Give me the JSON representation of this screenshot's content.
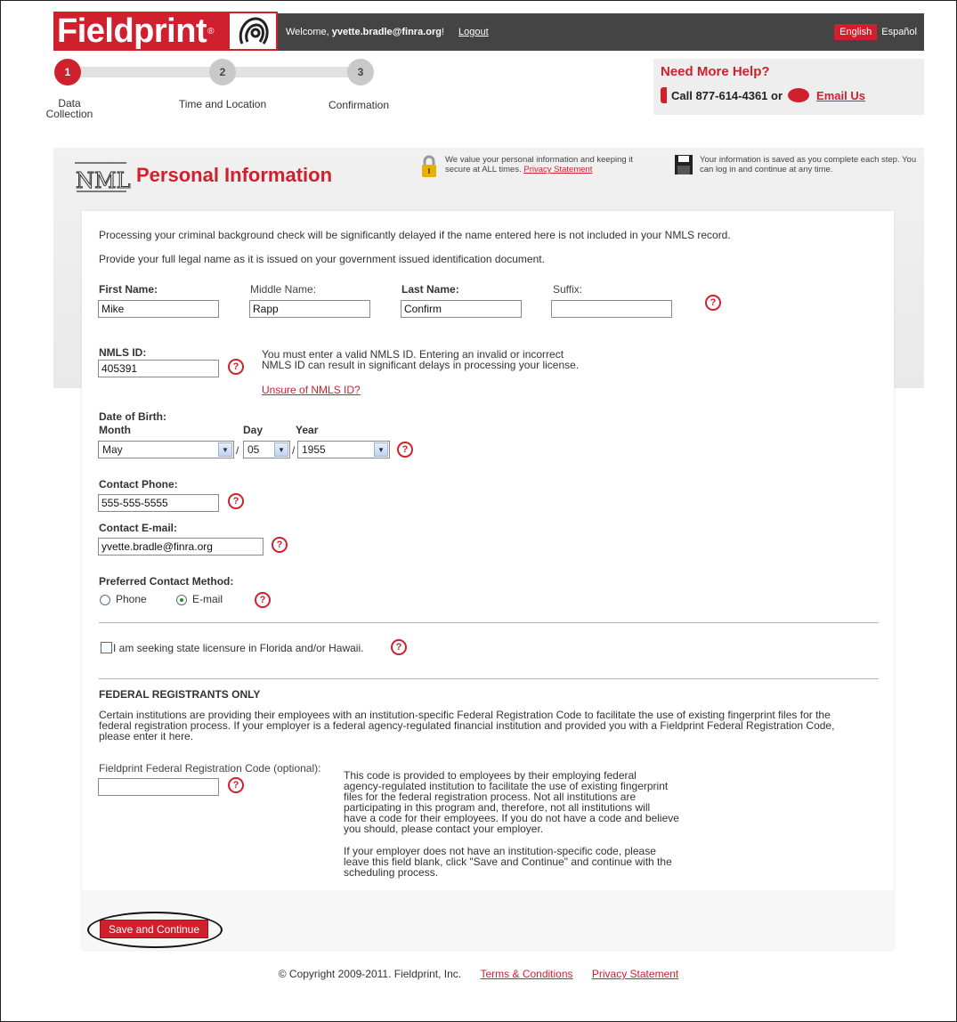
{
  "header": {
    "logo_text": "Fieldprint",
    "welcome_prefix": "Welcome, ",
    "welcome_user": "yvette.bradle@finra.org",
    "welcome_suffix": "!",
    "logout": "Logout",
    "lang_english": "English",
    "lang_spanish": "Español"
  },
  "steps": [
    {
      "num": "1",
      "label": "Data Collection"
    },
    {
      "num": "2",
      "label": "Time and Location"
    },
    {
      "num": "3",
      "label": "Confirmation"
    }
  ],
  "help": {
    "title": "Need More Help?",
    "call": "Call 877-614-4361 or",
    "email": "Email Us"
  },
  "section": {
    "logo_text": "NMLS",
    "title": "Personal Information",
    "privacy_note": "We value your personal information and keeping it secure at ALL times.",
    "privacy_link": "Privacy Statement",
    "save_note": "Your information is saved as you complete each step. You can log in and continue at any time."
  },
  "intro": {
    "line1": "Processing your criminal background check will be significantly delayed if the name entered here is not included in your NMLS record.",
    "line2": "Provide your full legal name as it is issued on your government issued identification document."
  },
  "name": {
    "first_label": "First Name:",
    "first_value": "Mike",
    "middle_label": "Middle Name:",
    "middle_value": "Rapp",
    "last_label": "Last Name:",
    "last_value": "Confirm",
    "suffix_label": "Suffix:",
    "suffix_value": ""
  },
  "nmls": {
    "label": "NMLS ID:",
    "value": "405391",
    "note1": "You must enter a valid NMLS ID. Entering an invalid or incorrect",
    "note2": "NMLS ID can result in significant delays in processing your license.",
    "unsure_link": "Unsure of NMLS ID?"
  },
  "dob": {
    "label": "Date of Birth:",
    "month_label": "Month",
    "day_label": "Day",
    "year_label": "Year",
    "month": "May",
    "day": "05",
    "year": "1955",
    "sep": "/"
  },
  "contact": {
    "phone_label": "Contact Phone:",
    "phone_value": "555-555-5555",
    "email_label": "Contact E-mail:",
    "email_value": "yvette.bradle@finra.org",
    "method_label": "Preferred Contact Method:",
    "method_phone": "Phone",
    "method_email": "E-mail"
  },
  "licensure": {
    "label": "I am seeking state licensure in Florida and/or Hawaii."
  },
  "federal": {
    "heading": "FEDERAL REGISTRANTS ONLY",
    "p1": "Certain institutions are providing their employees with an institution-specific Federal Registration Code to facilitate the use of existing fingerprint files for the",
    "p2": "federal registration process. If your employer is a federal agency-regulated financial institution and provided you with a Fieldprint Federal Registration Code,",
    "p3": "please enter it here.",
    "code_label": "Fieldprint Federal Registration Code (optional):",
    "code_value": "",
    "info1": "This code is provided to employees by their employing federal",
    "info2": "agency-regulated institution to facilitate the use of existing fingerprint",
    "info3": "files for the federal registration process. Not all institutions are",
    "info4": "participating in this program and, therefore, not all institutions will",
    "info5": "have a code for their employees. If you do not have a code and believe",
    "info6": "you should, please contact your employer.",
    "info7": "If your employer does not have an institution-specific code, please",
    "info8": "leave this field blank, click \"Save and Continue\" and continue with the",
    "info9": "scheduling process."
  },
  "help_glyph": "?",
  "save_button": "Save and Continue",
  "footer": {
    "copyright": "© Copyright 2009-2011. Fieldprint, Inc.",
    "terms": "Terms & Conditions",
    "privacy": "Privacy Statement"
  },
  "colors": {
    "brand_red": "#d0202e",
    "topbar": "#444444"
  }
}
